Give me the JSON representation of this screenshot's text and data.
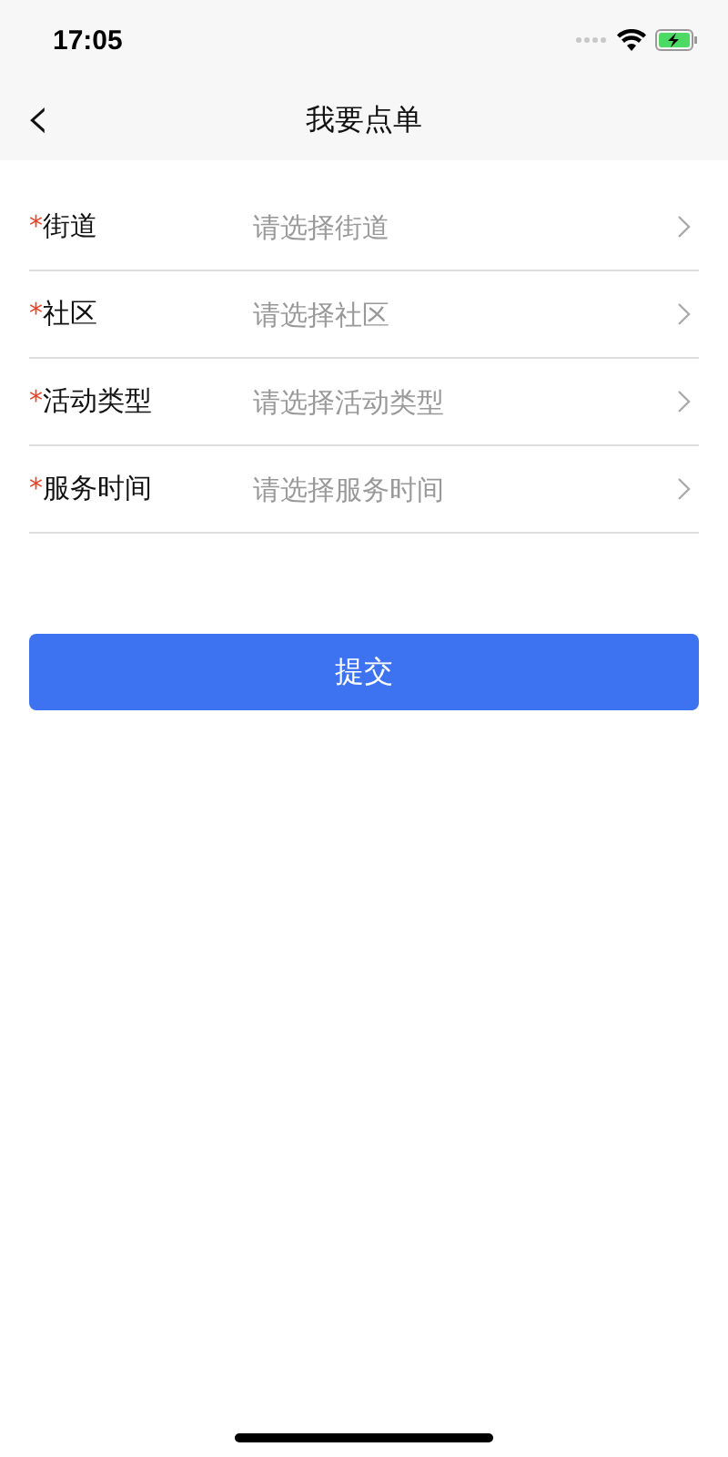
{
  "status_bar": {
    "time": "17:05"
  },
  "nav": {
    "back_glyph": "‹",
    "title": "我要点单"
  },
  "fields": [
    {
      "required_mark": "*",
      "label": "街道",
      "placeholder": "请选择街道"
    },
    {
      "required_mark": "*",
      "label": "社区",
      "placeholder": "请选择社区"
    },
    {
      "required_mark": "*",
      "label": "活动类型",
      "placeholder": "请选择活动类型"
    },
    {
      "required_mark": "*",
      "label": "服务时间",
      "placeholder": "请选择服务时间"
    }
  ],
  "submit_button": "提交"
}
